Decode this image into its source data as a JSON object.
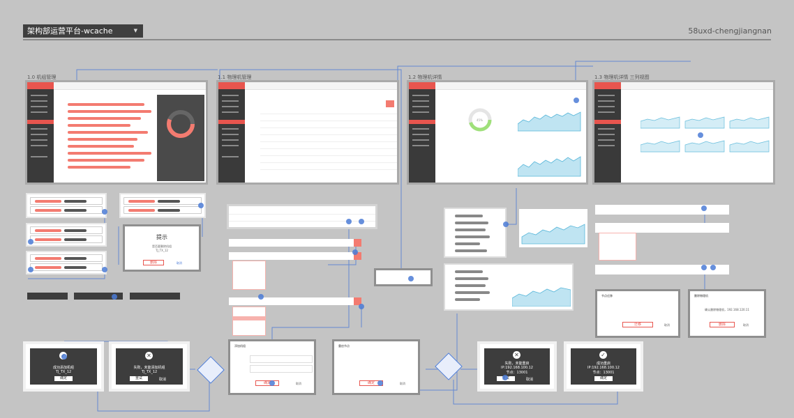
{
  "header": {
    "title": "架构部运营平台-wcache",
    "author": "58uxd-chengjiangnan"
  },
  "sections": {
    "s10": "1.0 机组管理",
    "s11": "1.1 物理机管理",
    "s12": "1.2 物理机详情",
    "s13": "1.3 物理机详情 三列视图"
  },
  "dialog_tip": {
    "title": "提示",
    "line1": "是否要删除机组",
    "line2": "TJ_TX_12",
    "cancel_btn": "取消",
    "confirm_btn": "删除"
  },
  "result_success": {
    "line1": "成功添加机组",
    "line2": "TJ_TX_12",
    "ok_btn": "确定"
  },
  "result_fail": {
    "line1": "失败，未能添加机组",
    "line2": "TJ_TX_12",
    "retry_btn": "重试",
    "cancel_btn": "取消"
  },
  "result_fail2": {
    "line1": "失败，未能重启",
    "line2": "IP:192.168.100.12",
    "line3": "节点：13001",
    "retry_btn": "重试",
    "cancel_btn": "取消"
  },
  "result_success2": {
    "line1": "成功重启",
    "line2": "IP:192.168.100.12",
    "line3": "节点：13001",
    "ok_btn": "确定"
  },
  "delete_dialog": {
    "title": "删除物理机",
    "line1": "确认删除物理机，192.168.120.11",
    "confirm_btn": "删除",
    "cancel_btn": "取消"
  },
  "add_dialog": {
    "title": "添加机组",
    "confirm_btn": "确定",
    "cancel_btn": "取消"
  },
  "restart_dialog": {
    "title": "重启节点",
    "confirm_btn": "确定",
    "cancel_btn": "取消"
  },
  "node_dialog": {
    "title": "节点迁移",
    "confirm_btn": "迁移",
    "cancel_btn": "取消"
  },
  "donut": {
    "pct": "45%"
  },
  "colors": {
    "accent": "#e8554e",
    "dark": "#3d3d3d",
    "link": "#4b7bd6",
    "bg": "#c4c4c4"
  }
}
